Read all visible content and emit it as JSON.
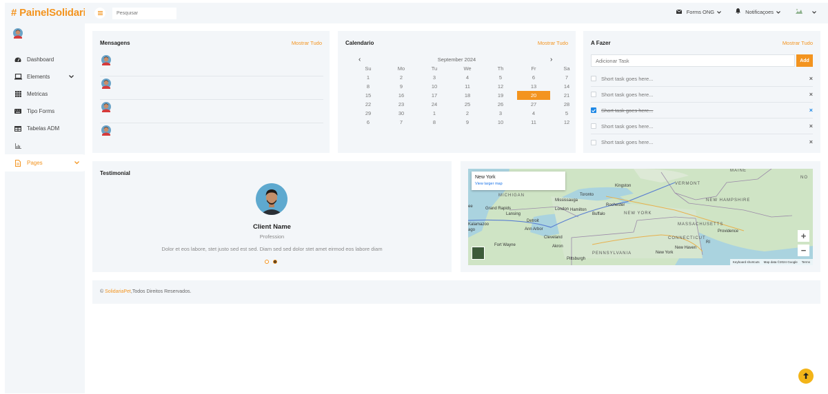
{
  "brand": "# PainelSolidaria",
  "search": {
    "placeholder": "Pesquisar"
  },
  "topbar": {
    "forms_label": "Forms ONG",
    "notifications_label": "Notificaçoes"
  },
  "sidebar": {
    "items": [
      {
        "label": "Dashboard",
        "icon": "tachometer-icon"
      },
      {
        "label": "Elements",
        "icon": "laptop-icon",
        "has_chevron": true
      },
      {
        "label": "Metricas",
        "icon": "grid-icon"
      },
      {
        "label": "Tipo Forms",
        "icon": "keyboard-icon"
      },
      {
        "label": "Tabelas ADM",
        "icon": "table-icon"
      },
      {
        "label": "",
        "icon": "chart-icon"
      },
      {
        "label": "Pages",
        "icon": "file-icon",
        "has_chevron": true,
        "active": true
      }
    ]
  },
  "messages": {
    "title": "Mensagens",
    "show_all": "Mostrar Tudo",
    "count": 4
  },
  "calendar": {
    "title": "Calendario",
    "show_all": "Mostrar Tudo",
    "month": "September 2024",
    "weekdays": [
      "Su",
      "Mo",
      "Tu",
      "We",
      "Th",
      "Fr",
      "Sa"
    ],
    "days": [
      "1",
      "2",
      "3",
      "4",
      "5",
      "6",
      "7",
      "8",
      "9",
      "10",
      "11",
      "12",
      "13",
      "14",
      "15",
      "16",
      "17",
      "18",
      "19",
      "20",
      "21",
      "22",
      "23",
      "24",
      "25",
      "26",
      "27",
      "28",
      "29",
      "30",
      "1",
      "2",
      "3",
      "4",
      "5",
      "6",
      "7",
      "8",
      "9",
      "10",
      "11",
      "12"
    ],
    "today": "20"
  },
  "todo": {
    "title": "A Fazer",
    "show_all": "Mostrar Tudo",
    "input_placeholder": "Adicionar Task",
    "add_label": "Add",
    "tasks": [
      {
        "text": "Short task goes here...",
        "done": false
      },
      {
        "text": "Short task goes here...",
        "done": false
      },
      {
        "text": "Short task goes here...",
        "done": true
      },
      {
        "text": "Short task goes here...",
        "done": false
      },
      {
        "text": "Short task goes here...",
        "done": false
      }
    ]
  },
  "testimonial": {
    "title": "Testimonial",
    "client_name": "Client Name",
    "profession": "Profession",
    "quote": "Dolor et eos labore, stet justo sed est sed. Diam sed sed dolor stet amet eirmod eos labore diam"
  },
  "map": {
    "city": "New York",
    "link": "View larger map",
    "zoom_in": "+",
    "zoom_out": "−",
    "footer": [
      "Keyboard shortcuts",
      "Map data ©2024 Google",
      "Terms"
    ],
    "labels": {
      "maine": "MAINE",
      "vermont": "VERMONT",
      "new_hampshire": "NEW HAMPSHIRE",
      "massachusetts": "MASSACHUSETTS",
      "connecticut": "CONNECTICUT",
      "ri": "RI",
      "new_york_state": "NEW YORK",
      "pennsylvania": "PENNSYLVANIA",
      "michigan": "MICHIGAN",
      "toronto": "Toronto",
      "mississauga": "Mississauga",
      "hamilton": "Hamilton",
      "london": "London",
      "detroit": "Detroit",
      "ann_arbor": "Ann Arbor",
      "cleveland": "Cleveland",
      "akron": "Akron",
      "pittsburgh": "Pittsburgh",
      "new_york_city": "New York",
      "buffalo": "Buffalo",
      "rochester": "Rochester",
      "kingston": "Kingston",
      "fort_wayne": "Fort Wayne",
      "providence": "Providence",
      "new_haven": "New Haven",
      "lansing": "Lansing",
      "kalamazoo": "Kalamazoo",
      "grand_rapids": "Grand Rapids",
      "ago": "ago",
      "ee": "ee",
      "no": "NO"
    }
  },
  "footer": {
    "brand": "SolidariaPet",
    "rest": ",Todos Direitos Reservados."
  },
  "colors": {
    "accent": "#f3941f",
    "panel": "#f3f6f9",
    "check": "#1e88e5"
  }
}
